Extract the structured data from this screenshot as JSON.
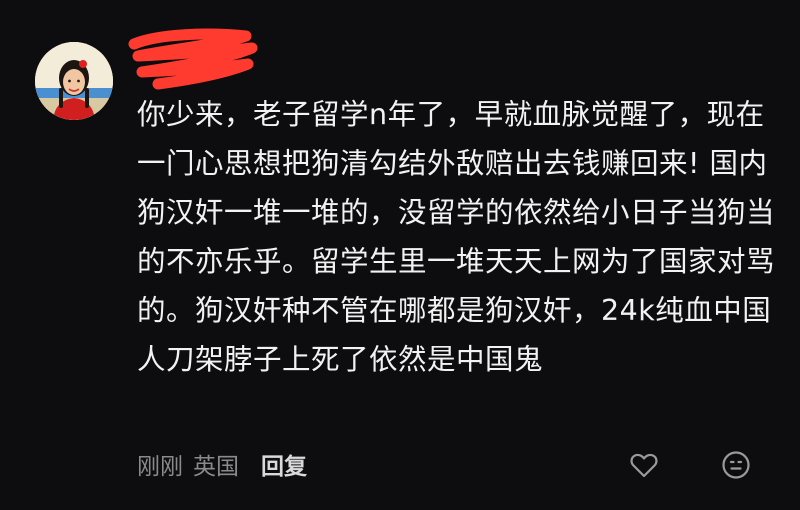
{
  "comment": {
    "text": "你少来，老子留学n年了，早就血脉觉醒了，现在一门心思想把狗清勾结外敌赔出去钱赚回来! 国内狗汉奸一堆一堆的，没留学的依然给小日子当狗当的不亦乐乎。留学生里一堆天天上网为了国家对骂的。狗汉奸种不管在哪都是狗汉奸，24k纯血中国人刀架脖子上死了依然是中国鬼",
    "time": "刚刚",
    "location": "英国",
    "reply_label": "回复"
  },
  "icons": {
    "avatar": "avatar-portrait",
    "username": "redacted-scribble",
    "like": "heart-outline-icon",
    "emoji": "emoji-face-icon"
  },
  "colors": {
    "background": "#0d0d0f",
    "text": "#f2f2f2",
    "meta": "#8a8a8e",
    "redaction": "#ff3b30"
  }
}
